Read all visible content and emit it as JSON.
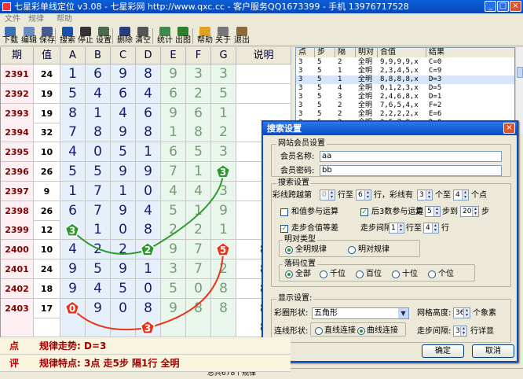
{
  "window": {
    "title": "七星彩单线定位 v3.08 - 七星彩网 http://www.qxc.cc - 客户服务QQ1673399 - 手机 13976717528"
  },
  "menu": [
    "文件",
    "规律",
    "帮助"
  ],
  "toolbar": [
    {
      "label": "下载",
      "icon": "download-icon",
      "color": "#3b6fb3"
    },
    {
      "label": "编辑",
      "icon": "edit-icon",
      "color": "#6a8bc0"
    },
    {
      "label": "保存",
      "icon": "save-icon",
      "color": "#445a90"
    },
    {
      "label": "搜索",
      "icon": "play-icon",
      "color": "#1b50a8"
    },
    {
      "label": "停止",
      "icon": "pause-icon",
      "color": "#333"
    },
    {
      "label": "设置",
      "icon": "settings-icon",
      "color": "#4b6b4b"
    },
    {
      "label": "删除",
      "icon": "delete-icon",
      "color": "#2a3c7a"
    },
    {
      "label": "清空",
      "icon": "clear-icon",
      "color": "#555"
    },
    {
      "label": "统计",
      "icon": "stats-icon",
      "color": "#3d8a4d"
    },
    {
      "label": "出图",
      "icon": "chart-icon",
      "color": "#2e7f2e"
    },
    {
      "label": "帮助",
      "icon": "help-icon",
      "color": "#e0a020"
    },
    {
      "label": "关于",
      "icon": "about-icon",
      "color": "#777"
    },
    {
      "label": "退出",
      "icon": "exit-icon",
      "color": "#8a6a3a"
    }
  ],
  "grid": {
    "headers": [
      "期",
      "值",
      "A",
      "B",
      "C",
      "D",
      "E",
      "F",
      "G",
      "说明"
    ],
    "rows": [
      {
        "period": "2391",
        "value": "24",
        "digits": [
          "1",
          "6",
          "9",
          "8",
          "9",
          "3",
          "3"
        ],
        "note": ""
      },
      {
        "period": "2392",
        "value": "19",
        "digits": [
          "5",
          "4",
          "6",
          "4",
          "6",
          "2",
          "5"
        ],
        "note": ""
      },
      {
        "period": "2393",
        "value": "19",
        "digits": [
          "8",
          "1",
          "4",
          "6",
          "9",
          "6",
          "1"
        ],
        "note": ""
      },
      {
        "period": "2394",
        "value": "32",
        "digits": [
          "7",
          "8",
          "9",
          "8",
          "1",
          "8",
          "2"
        ],
        "note": ""
      },
      {
        "period": "2395",
        "value": "10",
        "digits": [
          "4",
          "0",
          "5",
          "1",
          "6",
          "5",
          "3"
        ],
        "note": ""
      },
      {
        "period": "2396",
        "value": "26",
        "digits": [
          "5",
          "5",
          "9",
          "9",
          "7",
          "1",
          "3"
        ],
        "note": ""
      },
      {
        "period": "2397",
        "value": "9",
        "digits": [
          "1",
          "7",
          "1",
          "0",
          "4",
          "4",
          "3"
        ],
        "note": ""
      },
      {
        "period": "2398",
        "value": "26",
        "digits": [
          "6",
          "7",
          "9",
          "4",
          "5",
          "1",
          "9"
        ],
        "note": ""
      },
      {
        "period": "2399",
        "value": "12",
        "digits": [
          "3",
          "1",
          "0",
          "8",
          "2",
          "2",
          "1"
        ],
        "note": ""
      },
      {
        "period": "2400",
        "value": "10",
        "digits": [
          "4",
          "2",
          "2",
          "2",
          "9",
          "7",
          "5"
        ],
        "note": "8"
      },
      {
        "period": "2401",
        "value": "24",
        "digits": [
          "9",
          "5",
          "9",
          "1",
          "3",
          "7",
          "2"
        ],
        "note": "8"
      },
      {
        "period": "2402",
        "value": "18",
        "digits": [
          "9",
          "4",
          "5",
          "0",
          "5",
          "0",
          "8"
        ],
        "note": "8"
      },
      {
        "period": "2403",
        "value": "17",
        "digits": [
          "0",
          "9",
          "0",
          "8",
          "9",
          "8",
          "8"
        ],
        "note": "8"
      },
      {
        "period": "",
        "value": "",
        "digits": [
          "",
          "",
          "",
          "",
          "",
          "",
          ""
        ],
        "note": "8"
      }
    ],
    "markers": [
      {
        "label": "3",
        "color": "#2a9a2a"
      },
      {
        "label": "3",
        "color": "#2a9a2a"
      },
      {
        "label": "2",
        "color": "#2a9a2a"
      },
      {
        "label": "0",
        "color": "#e8351a"
      },
      {
        "label": "3",
        "color": "#e8351a"
      },
      {
        "label": "5",
        "color": "#e8351a"
      }
    ]
  },
  "footer": [
    {
      "key": "点",
      "text": "规律走势: D=3"
    },
    {
      "key": "评",
      "text": "规律特点: 3点 走5步 隔1行 全明"
    }
  ],
  "list": {
    "headers": [
      "点",
      "步",
      "隔",
      "明对",
      "合值",
      "结果"
    ],
    "rows": [
      [
        "3",
        "5",
        "2",
        "全明",
        "9,9,9,9,x",
        "C=0"
      ],
      [
        "3",
        "5",
        "1",
        "全明",
        "2,3,4,5,x",
        "C=9"
      ],
      [
        "3",
        "5",
        "1",
        "全明",
        "8,8,8,8,x",
        "D=3"
      ],
      [
        "3",
        "5",
        "4",
        "全明",
        "0,1,2,3,x",
        "D=5"
      ],
      [
        "3",
        "5",
        "3",
        "全明",
        "2,4,6,8,x",
        "D=1"
      ],
      [
        "3",
        "5",
        "2",
        "全明",
        "7,6,5,4,x",
        "F=2"
      ],
      [
        "3",
        "5",
        "2",
        "全明",
        "2,2,2,2,x",
        "E=6"
      ],
      [
        "3",
        "5",
        "2",
        "全明",
        "3,5,7,9,x",
        "D=0"
      ]
    ]
  },
  "status": {
    "text": "总共678个规律"
  },
  "dialog": {
    "title": "搜索设置",
    "member_group": "网站会员设置",
    "member_name_label": "会员名称:",
    "member_name_value": "aa",
    "member_pwd_label": "会员密码:",
    "member_pwd_value": "bb",
    "search_group": "搜索设置",
    "row1": {
      "prefix": "彩线跨越第",
      "from": "0",
      "mid": "行至",
      "to": "6",
      "suffix1": "行，彩线有",
      "n1": "3",
      "mid2": "个至",
      "n2": "4",
      "suffix2": "个点"
    },
    "chk_sum": {
      "label": "和值参与运算",
      "checked": false
    },
    "chk_last3": {
      "label": "后3数参与运算",
      "checked": true
    },
    "walk": {
      "prefix": "走",
      "a": "5",
      "mid": "步到",
      "b": "20",
      "suffix": "步"
    },
    "chk_equal": {
      "label": "走步合值等差",
      "checked": true
    },
    "interval": {
      "prefix": "走步间隔",
      "a": "1",
      "mid": "行至",
      "b": "4",
      "suffix": "行"
    },
    "mingdui_group": "明对类型",
    "mingdui_opts": [
      {
        "label": "全明规律",
        "on": true
      },
      {
        "label": "明对规律",
        "on": false
      }
    ],
    "pos_group": "落码位置",
    "pos_opts": [
      {
        "label": "全部",
        "on": true
      },
      {
        "label": "千位",
        "on": false
      },
      {
        "label": "百位",
        "on": false
      },
      {
        "label": "十位",
        "on": false
      },
      {
        "label": "个位",
        "on": false
      }
    ],
    "display_group": "显示设置:",
    "shape_label": "彩圈形状:",
    "shape_value": "五角形",
    "grid_height_label": "网格高度:",
    "grid_height_value": "36",
    "grid_height_unit": "个象素",
    "line_label": "连线形状:",
    "line_opts": [
      {
        "label": "直线连接",
        "on": false
      },
      {
        "label": "曲线连接",
        "on": true
      }
    ],
    "step_label": "走步间隔:",
    "step_value": "3",
    "step_unit": "行详显",
    "ok": "确定",
    "cancel": "取消"
  }
}
